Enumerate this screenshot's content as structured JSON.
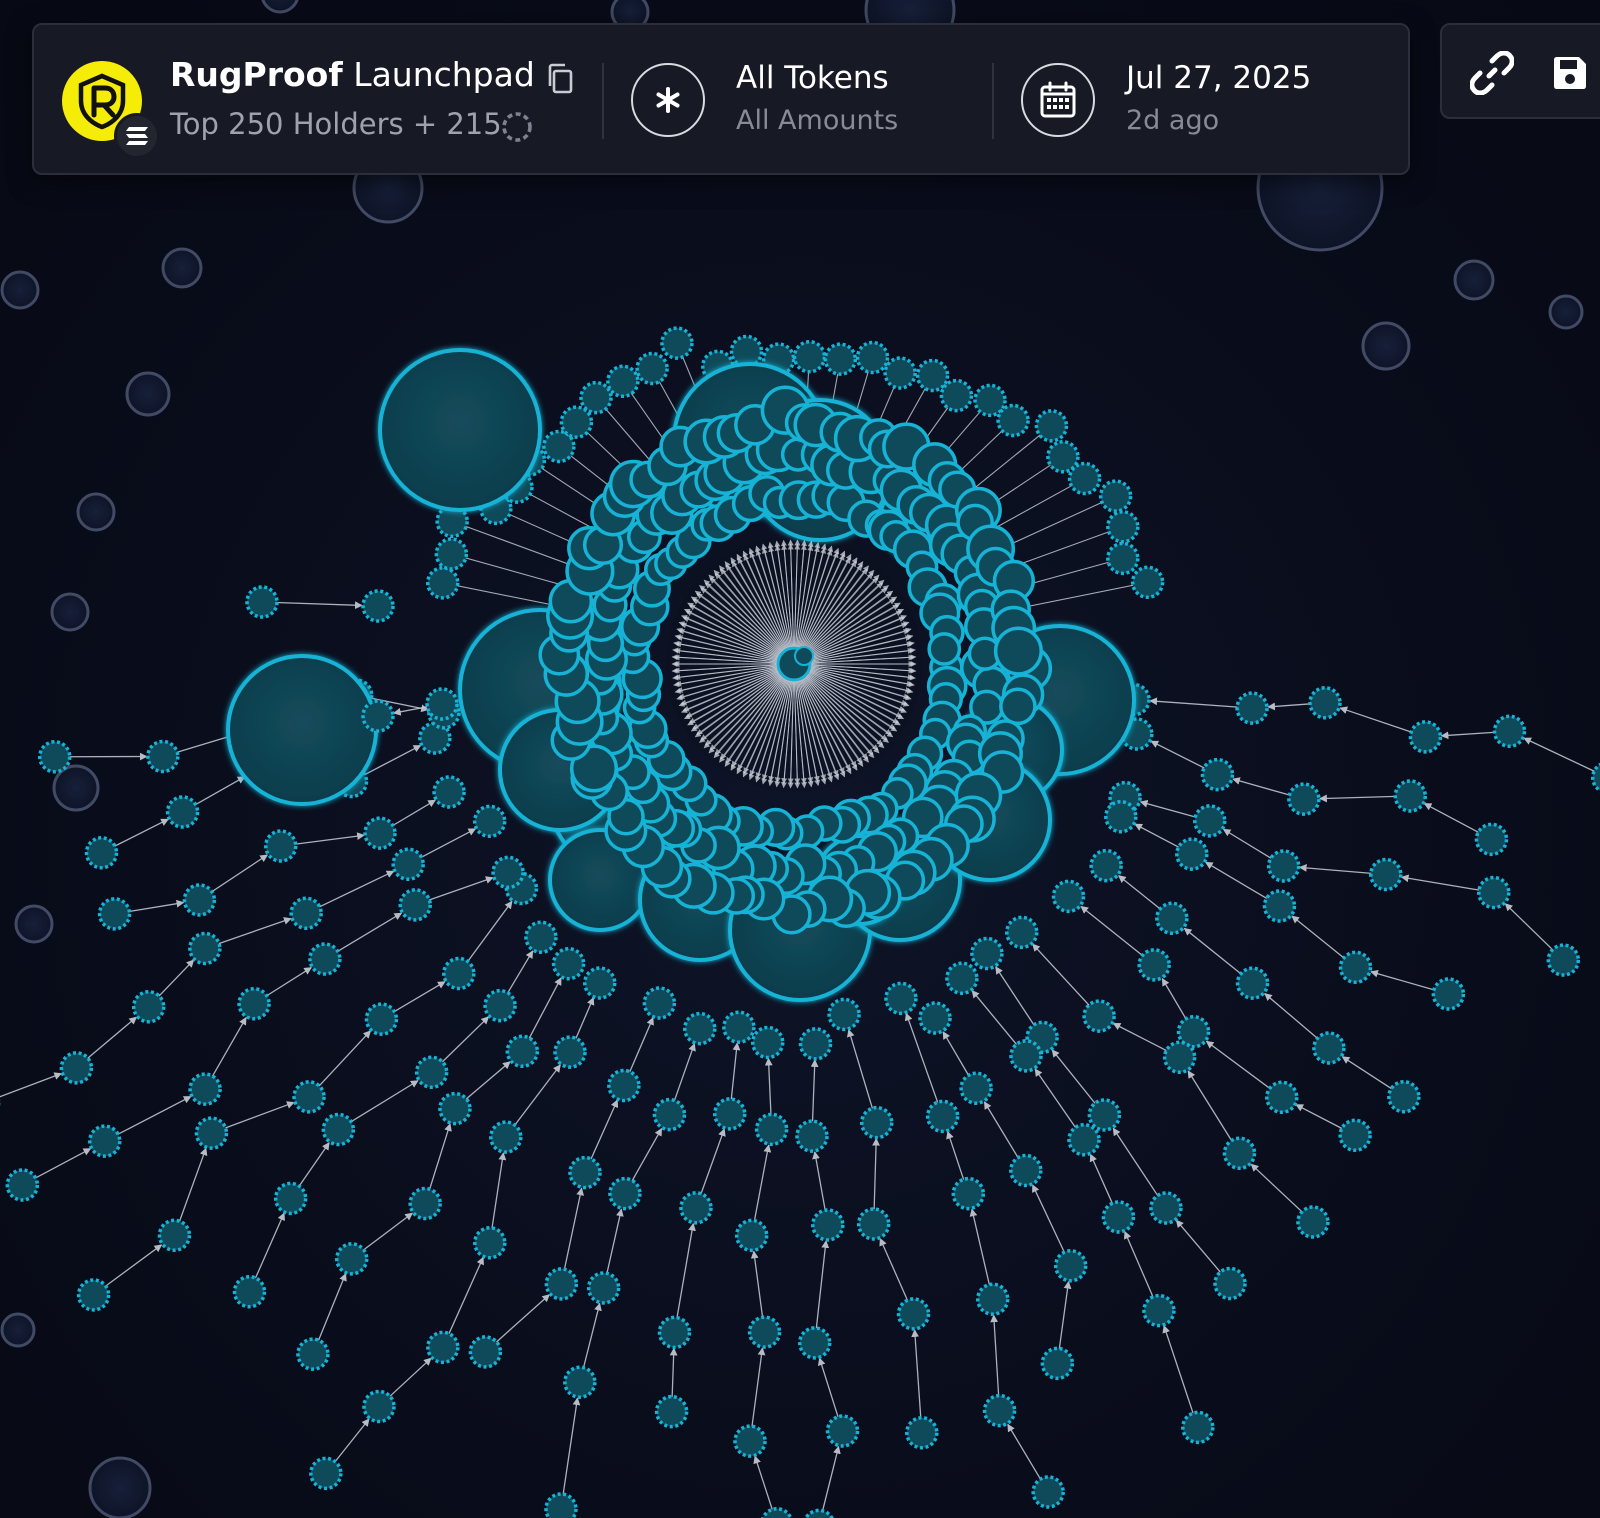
{
  "header": {
    "project_bold": "RugProof",
    "project_light": "Launchpad",
    "holders_label": "Top 250 Holders + 215",
    "token_filter": "All Tokens",
    "amount_filter": "All Amounts",
    "date": "Jul 27, 2025",
    "relative_date": "2d ago"
  },
  "icons": {
    "logo": "rugproof-logo-icon",
    "chain": "solana-icon",
    "copy": "copy-icon",
    "loading": "spinner-icon",
    "filter": "asterisk-icon",
    "calendar": "calendar-icon",
    "link": "link-icon",
    "save": "save-icon"
  },
  "colors": {
    "background": "#0a0d1c",
    "node_cyan": "#16b3d6",
    "node_fill": "#0f4a5a",
    "inactive_node": "#4c5673",
    "edge": "#c9ced8",
    "logo_yellow": "#f5ec08"
  }
}
